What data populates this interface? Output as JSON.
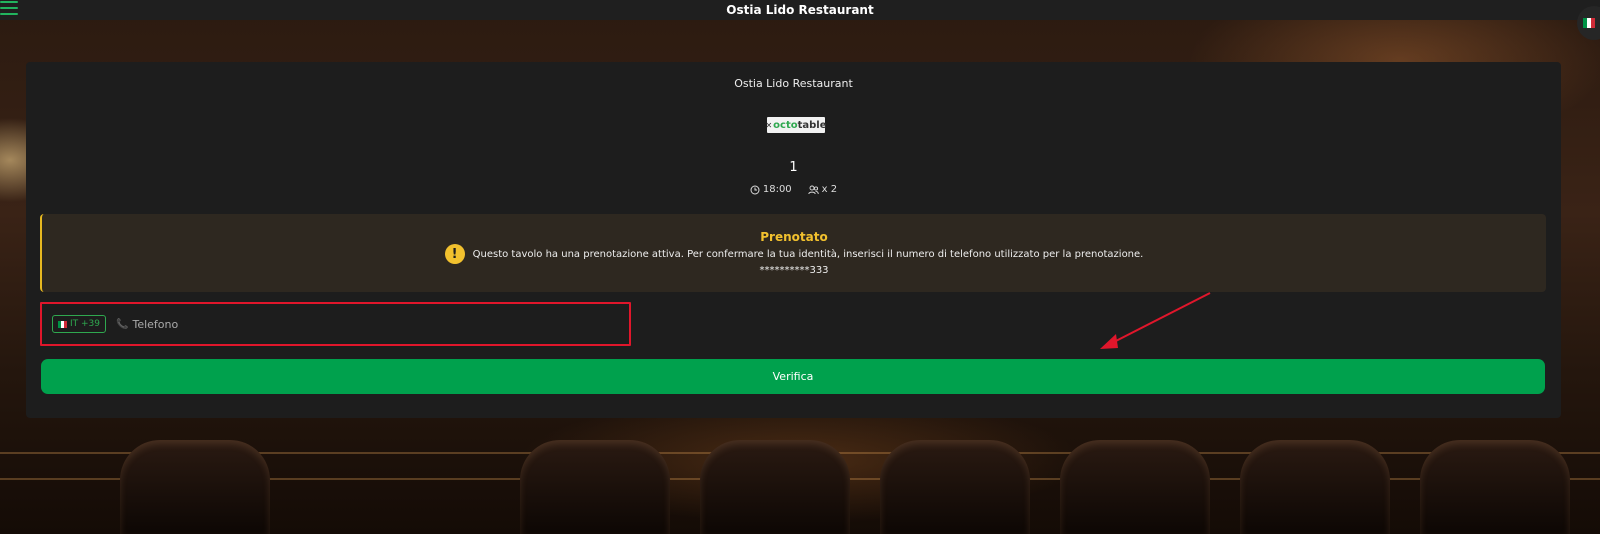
{
  "topbar": {
    "title": "Ostia Lido Restaurant"
  },
  "card": {
    "restaurant_name": "Ostia Lido Restaurant",
    "logo_text_prefix": "octo",
    "logo_text_suffix": "table",
    "table_number": "1",
    "time": "18:00",
    "guests": "x 2"
  },
  "alert": {
    "title": "Prenotato",
    "message": "Questo tavolo ha una prenotazione attiva. Per confermare la tua identità, inserisci il numero di telefono utilizzato per la prenotazione.",
    "masked_phone": "**********333"
  },
  "phone": {
    "country_code": "IT +39",
    "placeholder": "Telefono",
    "value": ""
  },
  "verify_button": {
    "label": "Verifica"
  },
  "colors": {
    "accent": "#00a14d",
    "warning": "#f2c12e",
    "highlight": "#e0162b"
  },
  "icons": {
    "menu": "hamburger-menu",
    "language": "italian-flag",
    "time": "clock",
    "guests": "people",
    "warning": "exclamation-circle",
    "phone": "telephone"
  }
}
